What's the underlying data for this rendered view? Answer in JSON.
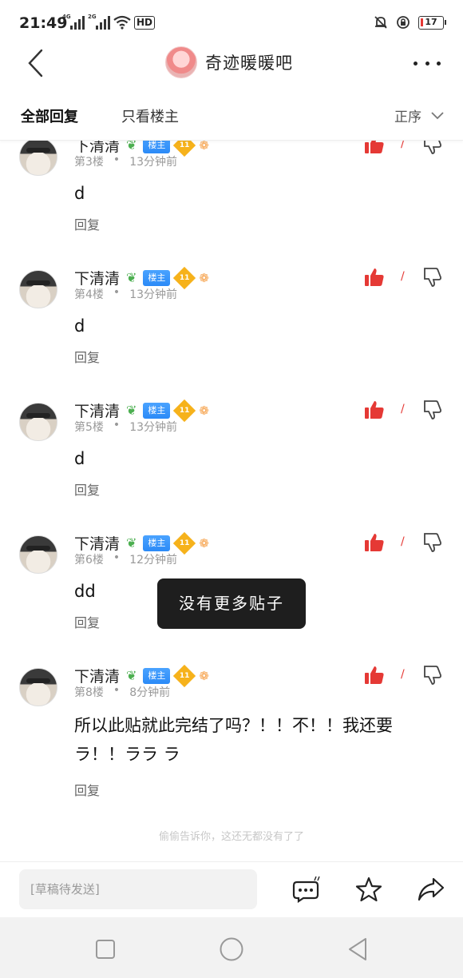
{
  "status_bar": {
    "time": "21:49",
    "net_4g": "4G",
    "net_2g": "2G",
    "hd": "HD",
    "battery": "17"
  },
  "header": {
    "forum_title": "奇迹暖暖吧"
  },
  "tabs": {
    "all": "全部回复",
    "op_only": "只看楼主",
    "sort": "正序"
  },
  "posts": [
    {
      "author": "下清清",
      "op_badge": "楼主",
      "level": "11",
      "floor": "第3楼",
      "time": "13分钟前",
      "content": "d",
      "reply": "回复"
    },
    {
      "author": "下清清",
      "op_badge": "楼主",
      "level": "11",
      "floor": "第4楼",
      "time": "13分钟前",
      "content": "d",
      "reply": "回复"
    },
    {
      "author": "下清清",
      "op_badge": "楼主",
      "level": "11",
      "floor": "第5楼",
      "time": "13分钟前",
      "content": "d",
      "reply": "回复"
    },
    {
      "author": "下清清",
      "op_badge": "楼主",
      "level": "11",
      "floor": "第6楼",
      "time": "12分钟前",
      "content": "dd",
      "reply": "回复"
    },
    {
      "author": "下清清",
      "op_badge": "楼主",
      "level": "11",
      "floor": "第8楼",
      "time": "8分钟前",
      "content": "所以此贴就此完结了吗？！！不！！我还要ラ！！ララ ラ",
      "reply": "回复"
    }
  ],
  "toast": "没有更多贴子",
  "footer_tip": "偷偷告诉你，这还无都没有了了",
  "bottom_bar": {
    "draft_placeholder": "[草稿待发送]"
  },
  "colors": {
    "accent_red": "#e53935",
    "op_badge_blue": "#2b8af7",
    "level_gold": "#f6b21b"
  }
}
